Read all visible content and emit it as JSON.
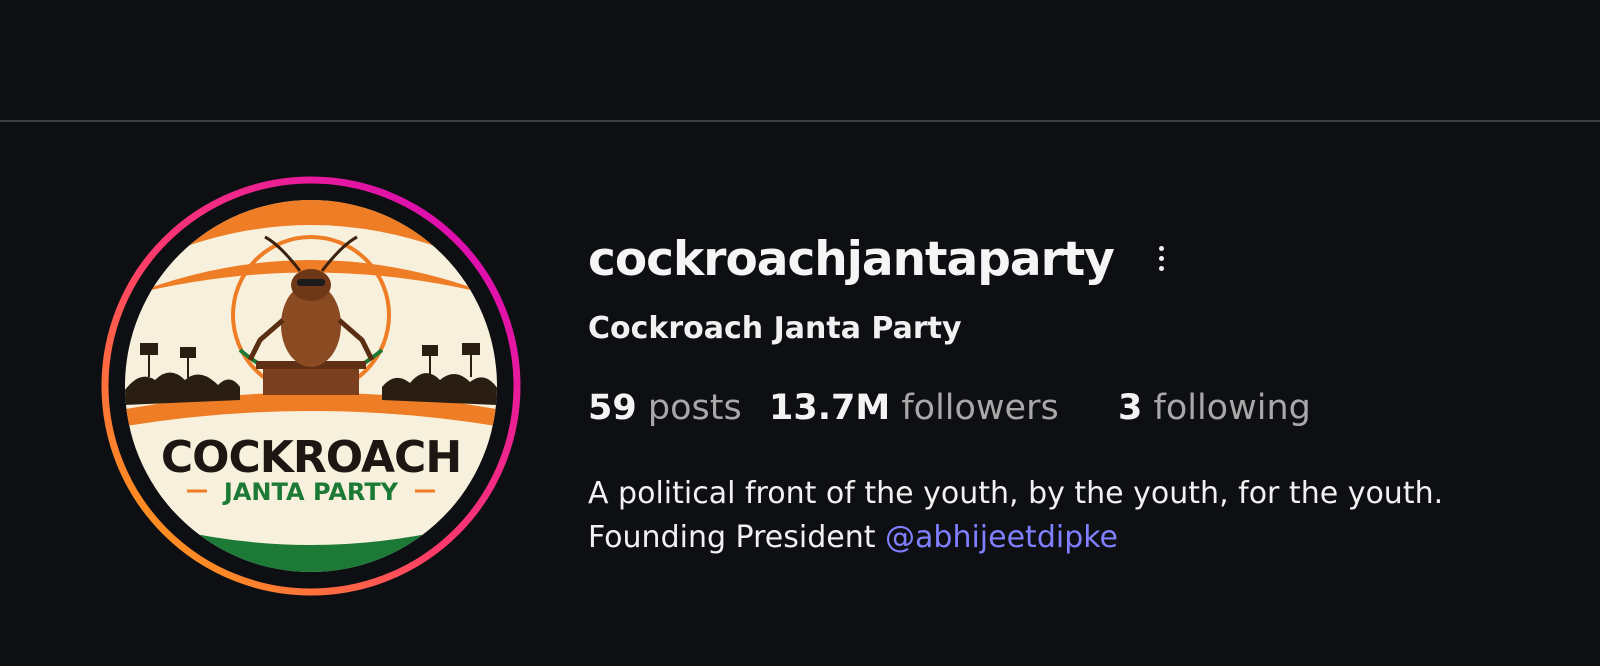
{
  "profile": {
    "username": "cockroachjantaparty",
    "full_name": "Cockroach Janta Party",
    "more_icon": "more-vertical-icon",
    "avatar_logo_text": {
      "line1": "COCKROACH",
      "line2": "JANTA PARTY"
    },
    "stats": {
      "posts_count": "59",
      "posts_label": "posts",
      "followers_count": "13.7M",
      "followers_label": "followers",
      "following_count": "3",
      "following_label": "following"
    },
    "bio": {
      "line1": "A political front of the youth, by the youth, for the youth.",
      "line2_prefix": "Founding President",
      "mention": "@abhijeetdipke"
    }
  },
  "colors": {
    "background": "#0d0f13",
    "text_primary": "#f3f3f3",
    "text_secondary": "#a8a8a8",
    "mention": "#7f7fff",
    "story_ring_start": "#ffb400",
    "story_ring_mid": "#ff3b6a",
    "story_ring_end": "#d300c5",
    "saffron": "#ee7d26",
    "green": "#1c7a36",
    "cream": "#f7f0dc"
  }
}
